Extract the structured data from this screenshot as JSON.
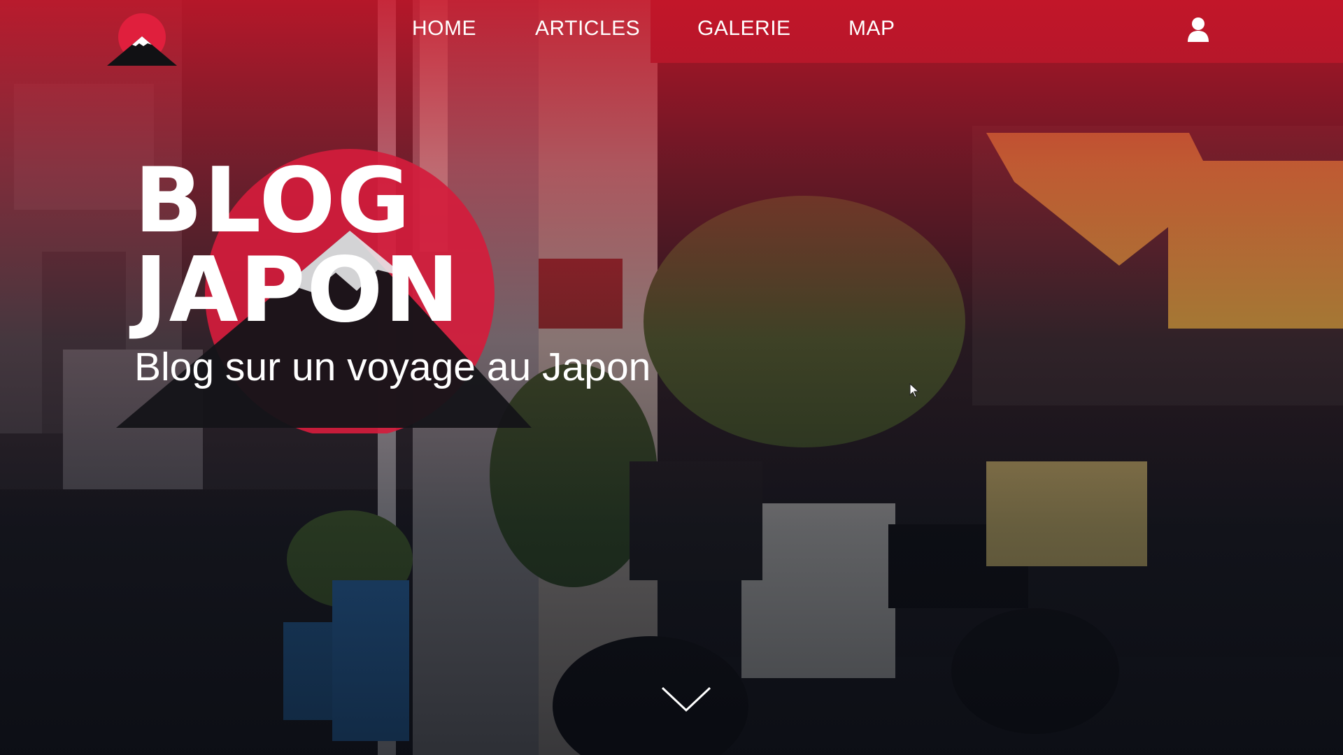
{
  "nav": {
    "items": [
      {
        "label": "HOME"
      },
      {
        "label": "ARTICLES"
      },
      {
        "label": "GALERIE"
      },
      {
        "label": "MAP"
      }
    ],
    "user_icon": "user-icon",
    "logo_icon": "mount-fuji-logo"
  },
  "hero": {
    "title_line1": "BLOG",
    "title_line2": "JAPON",
    "subtitle": "Blog sur un voyage au Japon",
    "scroll_icon": "chevron-down-icon"
  },
  "colors": {
    "accent_red": "#d41c3c",
    "text": "#ffffff",
    "dark": "#141418"
  }
}
